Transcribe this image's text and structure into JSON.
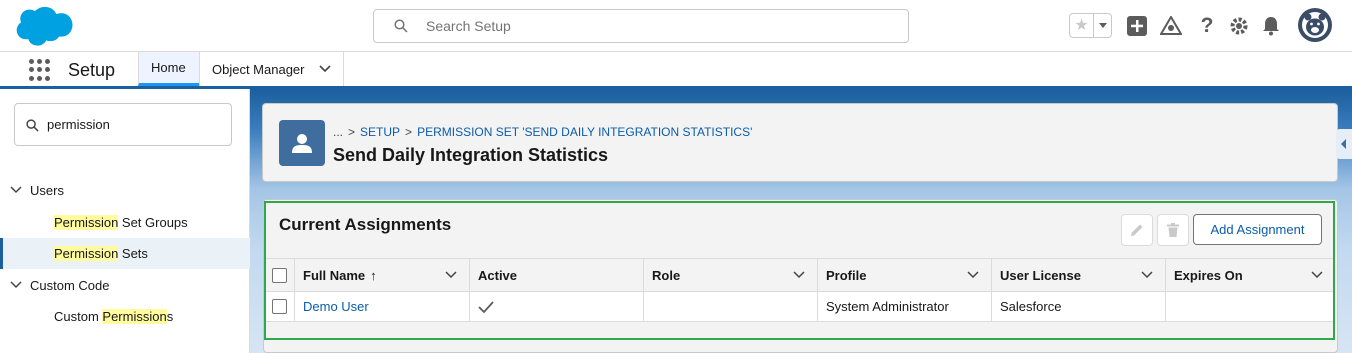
{
  "header": {
    "search_placeholder": "Search Setup",
    "icons": [
      "salesforce-cloud-logo",
      "search-icon",
      "star-icon",
      "chevron-down-icon",
      "plus-icon",
      "trailhead-icon",
      "help-icon",
      "gear-icon",
      "bell-icon",
      "avatar"
    ]
  },
  "context_bar": {
    "app_name": "Setup",
    "tabs": [
      {
        "label": "Home",
        "active": true
      },
      {
        "label": "Object Manager",
        "active": false
      }
    ]
  },
  "sidebar": {
    "quick_find_value": "permission",
    "groups": [
      {
        "label": "Users",
        "items": [
          {
            "highlight": "Permission",
            "rest": " Set Groups",
            "selected": false
          },
          {
            "highlight": "Permission",
            "rest": " Sets",
            "selected": true
          }
        ]
      },
      {
        "label": "Custom Code",
        "items": [
          {
            "pre": "Custom ",
            "highlight": "Permission",
            "rest": "s",
            "selected": false
          }
        ]
      }
    ]
  },
  "page_header": {
    "breadcrumb": [
      "...",
      "SETUP",
      "PERMISSION SET 'SEND DAILY INTEGRATION STATISTICS'"
    ],
    "title": "Send Daily Integration Statistics"
  },
  "assignments": {
    "title": "Current Assignments",
    "add_button": "Add Assignment",
    "columns": [
      "Full Name",
      "Active",
      "Role",
      "Profile",
      "User License",
      "Expires On"
    ],
    "sort_indicator": "↑",
    "rows": [
      {
        "full_name": "Demo User",
        "active": true,
        "role": "",
        "profile": "System Administrator",
        "user_license": "Salesforce",
        "expires_on": ""
      }
    ]
  },
  "colors": {
    "brand_blue": "#1b5f9e",
    "link_blue": "#0b5cab",
    "highlight_yellow": "#fffb9e",
    "annotation_green": "#2ea84a"
  }
}
